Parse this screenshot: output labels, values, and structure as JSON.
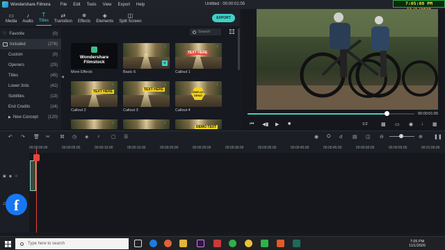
{
  "window": {
    "app_name": "Wondershare Filmora",
    "document_title": "Untitled : 00:00:01:05",
    "menu": [
      "File",
      "Edit",
      "Tools",
      "View",
      "Export",
      "Help"
    ],
    "overlay_clock": "7:05:08 PM 11/1/2020",
    "controls": [
      "–",
      "□",
      "✕"
    ]
  },
  "tabs": [
    {
      "label": "Media",
      "icon": "folder-icon",
      "glyph": "▭",
      "active": false
    },
    {
      "label": "Audio",
      "icon": "music-note-icon",
      "glyph": "♪",
      "active": false
    },
    {
      "label": "Titles",
      "icon": "title-t-icon",
      "glyph": "T",
      "active": true
    },
    {
      "label": "Transition",
      "icon": "transition-icon",
      "glyph": "⇄",
      "active": false
    },
    {
      "label": "Effects",
      "icon": "effects-icon",
      "glyph": "✵",
      "active": false
    },
    {
      "label": "Elements",
      "icon": "elements-icon",
      "glyph": "◈",
      "active": false
    },
    {
      "label": "Split Screen",
      "icon": "split-screen-icon",
      "glyph": "◫",
      "active": false
    }
  ],
  "export_label": "EXPORT",
  "sidebar": {
    "items": [
      {
        "label": "Favorite",
        "count": "(0)",
        "kind": "fav"
      },
      {
        "label": "Included",
        "count": "(276)",
        "kind": "sel"
      },
      {
        "label": "Custom",
        "count": "(0)",
        "kind": "sub"
      },
      {
        "label": "Openers",
        "count": "(25)",
        "kind": "sub"
      },
      {
        "label": "Titles",
        "count": "(45)",
        "kind": "sub"
      },
      {
        "label": "Lower 3rds",
        "count": "(42)",
        "kind": "sub"
      },
      {
        "label": "Subtitles",
        "count": "(13)",
        "kind": "sub"
      },
      {
        "label": "End Credits",
        "count": "(14)",
        "kind": "sub"
      },
      {
        "label": "New Concept",
        "count": "(120)",
        "kind": "subarrow"
      }
    ]
  },
  "search": {
    "placeholder": "Search"
  },
  "thumbnails": [
    {
      "label": "More Effects",
      "type": "stock",
      "text": "Wondershare Filmstock"
    },
    {
      "label": "Basic 6",
      "type": "road",
      "badge": "+"
    },
    {
      "label": "Callout 1",
      "type": "banner",
      "banner": "TEXT HERE",
      "banner_color": "red"
    },
    {
      "label": "Callout 2",
      "type": "banner",
      "banner": "TEXT HERE",
      "banner_color": "yellow"
    },
    {
      "label": "Callout 3",
      "type": "banner",
      "banner": "TEXT HERE",
      "banner_color": "yellow"
    },
    {
      "label": "Callout 4",
      "type": "hexagon",
      "banner": "TEMPLATE DEMO"
    },
    {
      "label": "",
      "type": "road"
    },
    {
      "label": "",
      "type": "road"
    },
    {
      "label": "",
      "type": "banner",
      "banner": "DEMO TEXT",
      "banner_color": "yellow"
    }
  ],
  "preview": {
    "timecode": "00:00:01:05",
    "page": "1/2",
    "progress": 0.83
  },
  "timeline": {
    "ruler": [
      "00:00:00:00",
      "00:00:05:00",
      "00:00:10:00",
      "00:00:15:00",
      "00:00:20:00",
      "00:00:25:00",
      "00:00:30:00",
      "00:00:35:00",
      "00:00:40:00",
      "00:00:45:00",
      "00:00:50:00",
      "00:00:55:00",
      "00:01:00:00"
    ]
  },
  "taskbar": {
    "search_placeholder": "Type here to search",
    "time": "7:05 PM",
    "date": "11/1/2020"
  },
  "colors": {
    "accent": "#3fd1c8",
    "playhead": "#e8453c",
    "facebook": "#1877f2"
  }
}
